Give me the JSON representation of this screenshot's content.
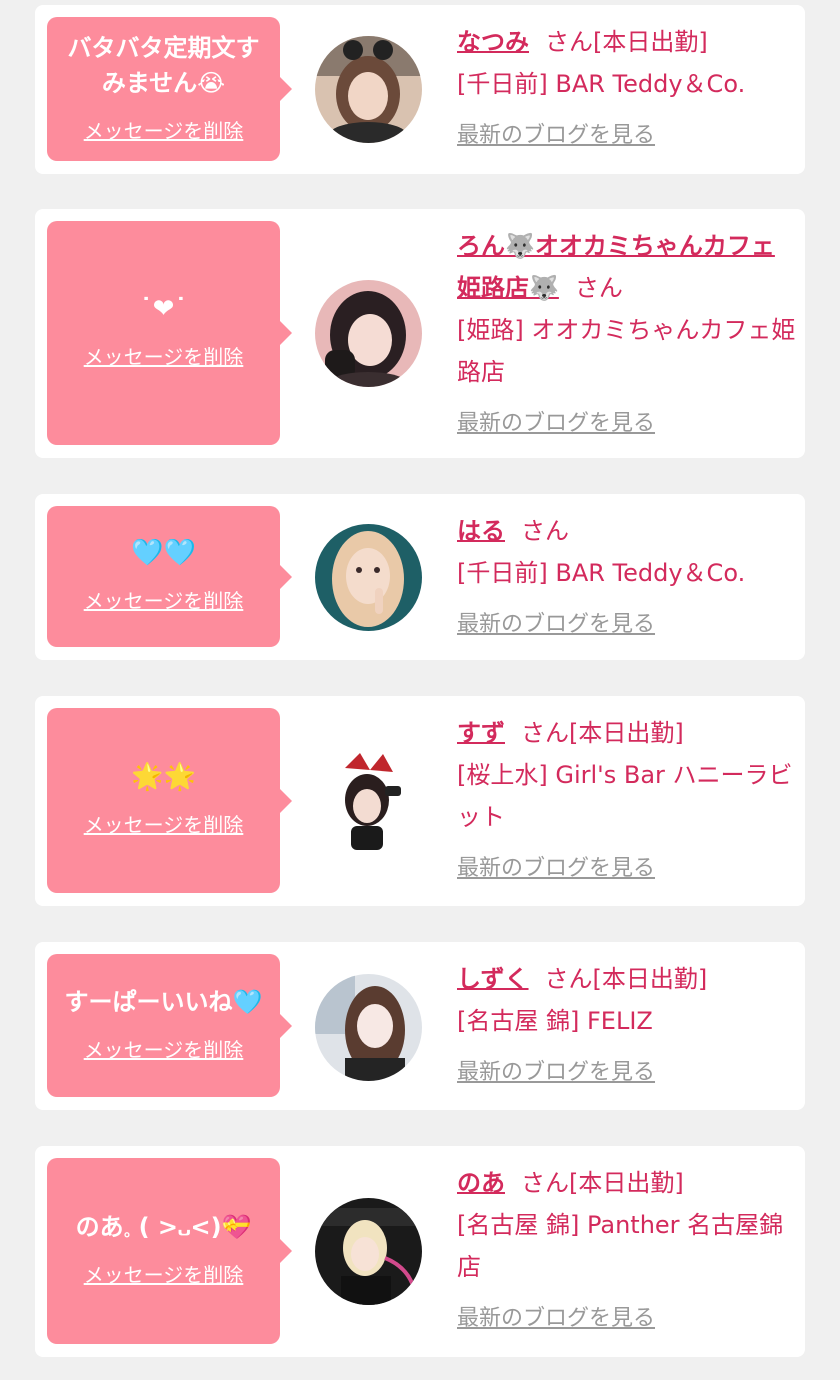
{
  "colors": {
    "page_bg": "#f0f0f0",
    "card_bg": "#ffffff",
    "bubble_bg": "#fd8c9c",
    "accent": "#d32a5c",
    "blog_link": "#999999"
  },
  "items": [
    {
      "message": "バタバタ定期文すみません😭",
      "delete_label": "メッセージを削除",
      "name": "なつみ",
      "honorific": "さん",
      "status": "[本日出勤]",
      "shop": "[千日前] BAR Teddy＆Co.",
      "blog_label": "最新のブログを見る",
      "avatar_icon": "avatar-photo"
    },
    {
      "message": "˙❤︎˙",
      "delete_label": "メッセージを削除",
      "name": "ろん🐺オオカミちゃんカフェ姫路店🐺",
      "honorific": "さん",
      "status": "",
      "shop": "[姫路] オオカミちゃんカフェ姫路店",
      "blog_label": "最新のブログを見る",
      "avatar_icon": "avatar-photo"
    },
    {
      "message": "🩵🩵",
      "delete_label": "メッセージを削除",
      "name": "はる",
      "honorific": "さん",
      "status": "",
      "shop": "[千日前] BAR Teddy＆Co.",
      "blog_label": "最新のブログを見る",
      "avatar_icon": "avatar-photo"
    },
    {
      "message": "🌟🌟",
      "delete_label": "メッセージを削除",
      "name": "すず",
      "honorific": "さん",
      "status": "[本日出勤]",
      "shop": "[桜上水] Girl's Bar ハニーラビット",
      "blog_label": "最新のブログを見る",
      "avatar_icon": "avatar-photo"
    },
    {
      "message": "すーぱーいいね🩵",
      "delete_label": "メッセージを削除",
      "name": "しずく",
      "honorific": "さん",
      "status": "[本日出勤]",
      "shop": "[名古屋 錦] FELIZ",
      "blog_label": "最新のブログを見る",
      "avatar_icon": "avatar-photo"
    },
    {
      "message": "のあ𓈒 ( >᎑<)💝",
      "delete_label": "メッセージを削除",
      "name": "のあ",
      "honorific": "さん",
      "status": "[本日出勤]",
      "shop": "[名古屋 錦] Panther 名古屋錦店",
      "blog_label": "最新のブログを見る",
      "avatar_icon": "avatar-photo"
    }
  ]
}
